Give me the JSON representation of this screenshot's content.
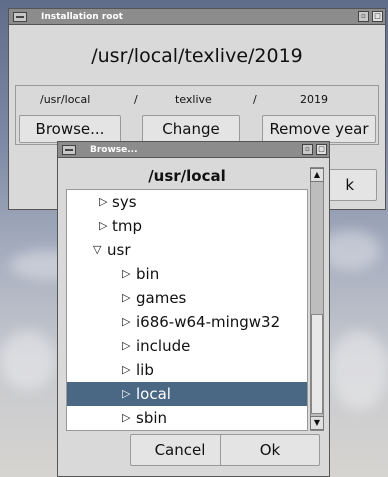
{
  "install_window": {
    "title": "Installation root",
    "path": "/usr/local/texlive/2019",
    "segments": [
      "/usr/local",
      "/",
      "texlive",
      "/",
      "2019"
    ],
    "buttons": {
      "browse": "Browse...",
      "change": "Change",
      "remove_year": "Remove year"
    },
    "ok_fragment": "k"
  },
  "browse_window": {
    "title": "Browse...",
    "current_dir": "/usr/local",
    "tree": [
      {
        "label": "sys",
        "expanded": false,
        "level": 1
      },
      {
        "label": "tmp",
        "expanded": false,
        "level": 1
      },
      {
        "label": "usr",
        "expanded": true,
        "level": 1
      },
      {
        "label": "bin",
        "expanded": false,
        "level": 2
      },
      {
        "label": "games",
        "expanded": false,
        "level": 2
      },
      {
        "label": "i686-w64-mingw32",
        "expanded": false,
        "level": 2
      },
      {
        "label": "include",
        "expanded": false,
        "level": 2
      },
      {
        "label": "lib",
        "expanded": false,
        "level": 2
      },
      {
        "label": "local",
        "expanded": false,
        "level": 2,
        "selected": true
      },
      {
        "label": "sbin",
        "expanded": false,
        "level": 2
      }
    ],
    "buttons": {
      "cancel": "Cancel",
      "ok": "Ok"
    }
  },
  "glyphs": {
    "collapsed": "▷",
    "expanded": "▽",
    "scroll_up": "▲",
    "scroll_down": "▼"
  },
  "colors": {
    "selection": "#4a6784",
    "titlebar": "#8c8c8c"
  }
}
